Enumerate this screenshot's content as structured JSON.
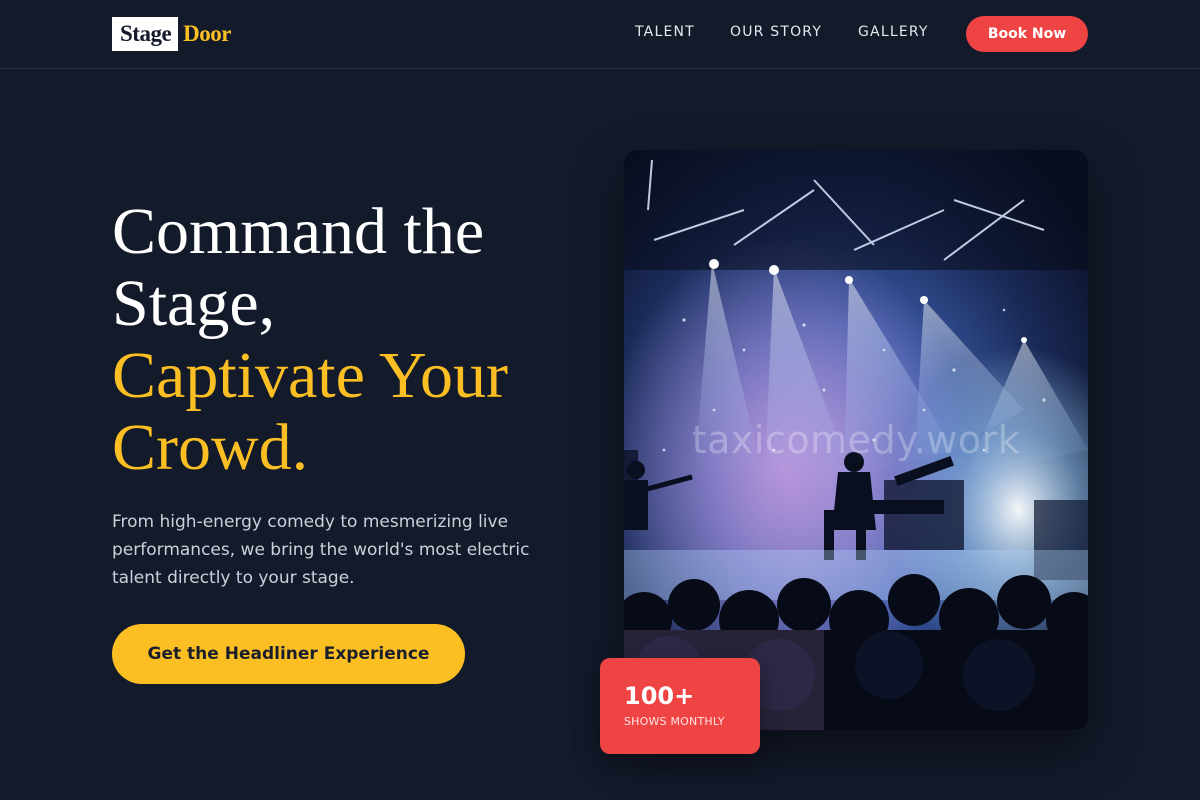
{
  "brand": {
    "logo_part1": "Stage",
    "logo_part2": "Door",
    "accent_color": "#fbbf24",
    "cta_color": "#ef4444",
    "background_color": "#131a2a"
  },
  "nav": {
    "items": [
      "TALENT",
      "OUR STORY",
      "GALLERY"
    ],
    "book_label": "Book Now"
  },
  "hero": {
    "headline_line1": "Command the",
    "headline_line2": "Stage,",
    "headline_line3": "Captivate Your",
    "headline_line4": "Crowd.",
    "subtext": "From high-energy comedy to mesmerizing live performances, we bring the world's most electric talent directly to your stage.",
    "cta_label": "Get the Headliner Experience"
  },
  "image": {
    "subject": "concert stage with spotlights and crowd",
    "watermark": "taxicomedy.work"
  },
  "stat": {
    "value": "100+",
    "label": "SHOWS MONTHLY"
  }
}
